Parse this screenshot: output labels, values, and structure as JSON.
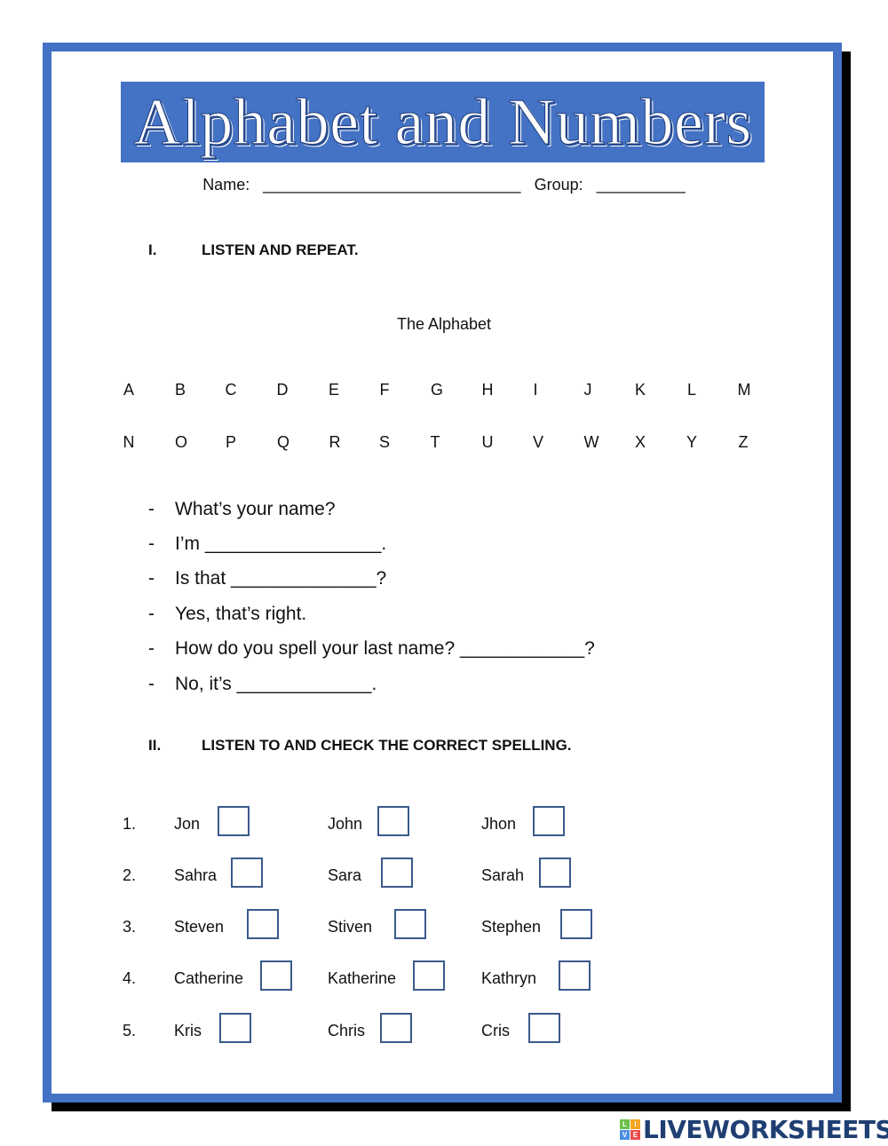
{
  "title": "Alphabet and Numbers",
  "header": {
    "name_label": "Name:",
    "name_blank": "_____________________________",
    "group_label": "Group:",
    "group_blank": "__________"
  },
  "section1": {
    "number": "I.",
    "heading": "LISTEN AND REPEAT.",
    "alphabet_title": "The Alphabet",
    "alphabet_rows": [
      [
        "A",
        "B",
        "C",
        "D",
        "E",
        "F",
        "G",
        "H",
        "I",
        "J",
        "K",
        "L",
        "M"
      ],
      [
        "N",
        "O",
        "P",
        "Q",
        "R",
        "S",
        "T",
        "U",
        "V",
        "W",
        "X",
        "Y",
        "Z"
      ]
    ],
    "dialog": [
      "What’s your name?",
      "I’m _________________.",
      "Is that ______________?",
      "Yes, that’s right.",
      "How do you spell your last name? ____________?",
      "No, it’s _____________."
    ],
    "bullet": "-"
  },
  "section2": {
    "number": "II.",
    "heading": "LISTEN TO AND CHECK THE CORRECT SPELLING.",
    "items": [
      {
        "num": "1.",
        "options": [
          "Jon",
          "John",
          "Jhon"
        ]
      },
      {
        "num": "2.",
        "options": [
          "Sahra",
          "Sara",
          "Sarah"
        ]
      },
      {
        "num": "3.",
        "options": [
          "Steven",
          "Stiven",
          "Stephen"
        ]
      },
      {
        "num": "4.",
        "options": [
          "Catherine",
          "Katherine",
          "Kathryn"
        ]
      },
      {
        "num": "5.",
        "options": [
          "Kris",
          "Chris",
          "Cris"
        ]
      }
    ]
  },
  "logo": {
    "icon_letters": [
      "L",
      "I",
      "V",
      "E"
    ],
    "icon_colors": [
      "#6cc04a",
      "#f5a623",
      "#4a90e2",
      "#e94e4e"
    ],
    "text": "LIVEWORKSHEETS"
  },
  "colors": {
    "frame_blue": "#4472c4",
    "checkbox_border": "#3a5a8c",
    "logo_text": "#1f3f72"
  }
}
